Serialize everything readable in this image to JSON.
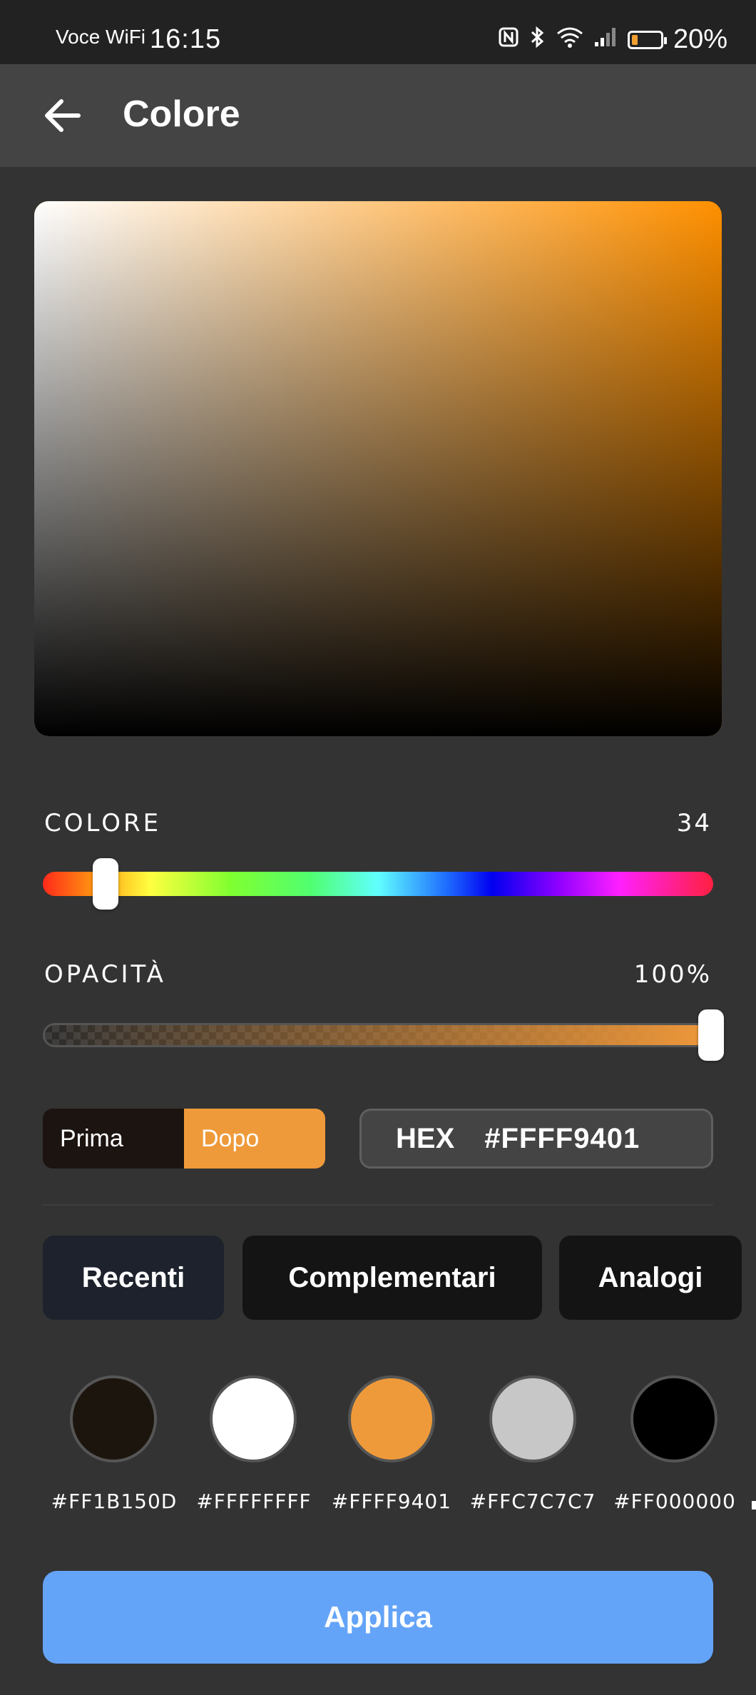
{
  "status_bar": {
    "carrier": "Voce WiFi",
    "time": "16:15",
    "battery_percent_label": "20%",
    "battery_level": 0.2,
    "icons": [
      "nfc-icon",
      "bluetooth-icon",
      "wifi-icon",
      "signal-icon",
      "battery-icon"
    ]
  },
  "app_bar": {
    "title": "Colore",
    "back_icon": "arrow-left-icon"
  },
  "picker": {
    "hue_degrees": 34,
    "saturation": 1.0,
    "value": 0.94,
    "selected_color": "#EF9A3A"
  },
  "hue_slider": {
    "label": "COLORE",
    "value": "34",
    "level": 0.094
  },
  "opacity_slider": {
    "label": "OPACITÀ",
    "value": "100%",
    "level": 1.0
  },
  "compare": {
    "before_label": "Prima",
    "after_label": "Dopo",
    "before_color": "#1C1410",
    "after_color": "#EF9A3A"
  },
  "hex": {
    "label": "HEX",
    "value": "#FFFF9401"
  },
  "tabs": [
    {
      "label": "Recenti",
      "active": true
    },
    {
      "label": "Complementari",
      "active": false
    },
    {
      "label": "Analogi",
      "active": false
    }
  ],
  "swatches": [
    {
      "label": "#FF1B150D",
      "color": "#1B150D"
    },
    {
      "label": "#FFFFFFFF",
      "color": "#FFFFFF"
    },
    {
      "label": "#FFFF9401",
      "color": "#EF9A3A"
    },
    {
      "label": "#FFC7C7C7",
      "color": "#C7C7C7"
    },
    {
      "label": "#FF000000",
      "color": "#000000"
    }
  ],
  "apply_button": {
    "label": "Applica",
    "color": "#64A4F8"
  }
}
